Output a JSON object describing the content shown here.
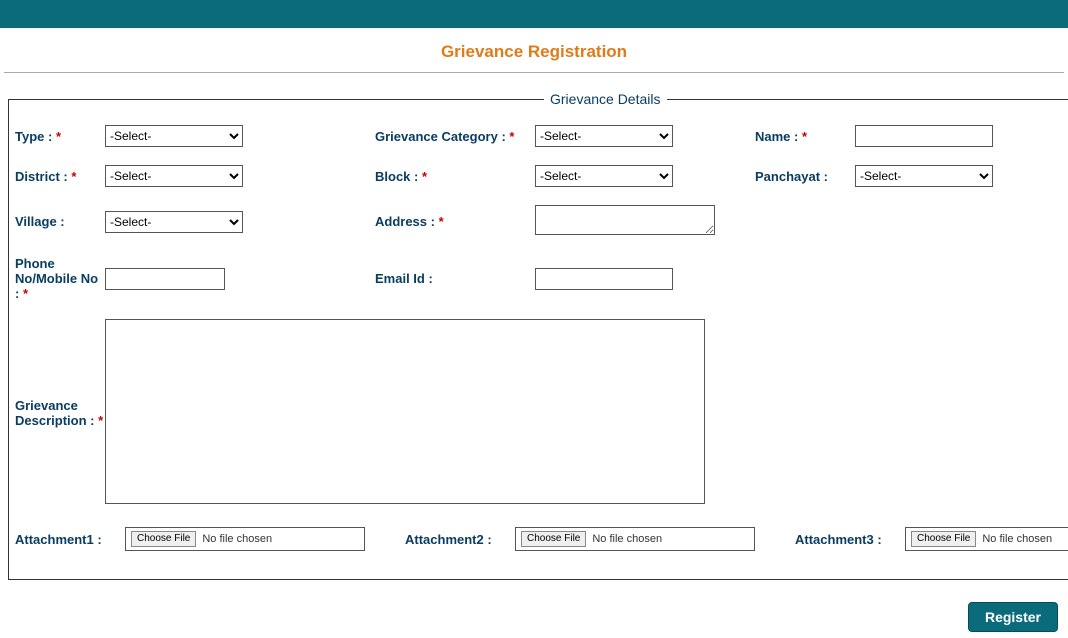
{
  "page_title": "Grievance Registration",
  "fieldset_legend": "Grievance Details",
  "labels": {
    "type": "Type :",
    "category": "Grievance Category :",
    "name": "Name :",
    "district": "District :",
    "block": "Block :",
    "panchayat": "Panchayat :",
    "village": "Village :",
    "address": "Address :",
    "phone": "Phone No/Mobile No :",
    "email": "Email Id :",
    "description": "Grievance Description :",
    "att1": "Attachment1 :",
    "att2": "Attachment2 :",
    "att3": "Attachment3 :"
  },
  "select_placeholder": "-Select-",
  "file": {
    "choose": "Choose File",
    "none": "No file chosen"
  },
  "register": "Register",
  "required_marker": "*"
}
